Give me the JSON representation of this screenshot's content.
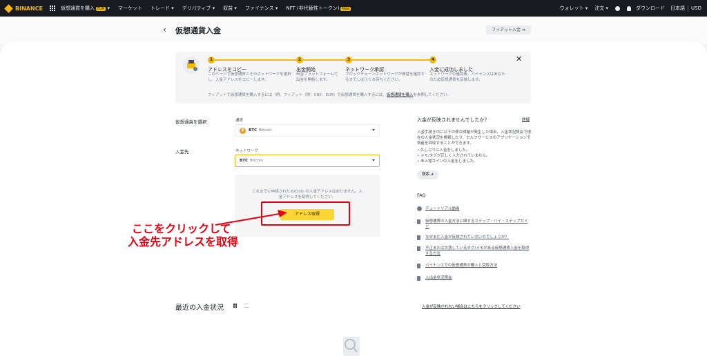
{
  "topbar": {
    "brand": "BINANCE",
    "nav": [
      "仮想通貨を購入",
      "マーケット",
      "トレード",
      "デリバティブ",
      "収益",
      "ファイナンス",
      "NFT (非代替性トークン)"
    ],
    "buy_badge": "EUR",
    "nft_badge": "New",
    "wallet": "ウォレット",
    "orders": "注文",
    "download": "ダウンロード",
    "language": "日本語",
    "currency": "USD"
  },
  "header": {
    "title": "仮想通貨入金",
    "fiat_button": "フィアット入金 ➔"
  },
  "steps": [
    {
      "num": "1",
      "title": "アドレスをコピー",
      "desc": "このページで仮想通貨とそのネットワークを選択し、入金アドレスをコピーします。"
    },
    {
      "num": "2",
      "title": "出金開始",
      "desc": "出金プラットフォームで出金を開始します。"
    },
    {
      "num": "3",
      "title": "ネットワーク承認",
      "desc": "ブロックチェーンネットワークが振替を確認するまでしばらくお待ちください。"
    },
    {
      "num": "4",
      "title": "入金に成功しました",
      "desc": "ネットワークの確認後、バイナンスはあなたのため仮想通貨を反映します。"
    }
  ],
  "steps_note": {
    "text": "フィアットで仮想通貨を購入するには（例、フィアット（例：CNY、EUR）で仮想通貨を購入するには、",
    "link": "仮想通貨を購入",
    "suffix": "を参照してください。"
  },
  "form": {
    "select_coin_label": "仮想通貨を選択",
    "coin_field_label": "通貨",
    "coin_code": "BTC",
    "coin_name": "Bitcoin",
    "deposit_to_label": "入金先",
    "network_field_label": "ネットワーク",
    "network_code": "BTC",
    "network_name": "Bitcoin",
    "address_message": "これまでに申請された Bitcoin の入金アドレスはありません。入金アドレスを取得してください。",
    "get_address_button": "アドレス取得"
  },
  "annotation": {
    "line1": "ここをクリックして",
    "line2": "入金先アドレスを取得",
    "color": "#e60012"
  },
  "side": {
    "title": "入金が反映されませんでしたか？",
    "detail_link": "詳細",
    "description": "入金手続き中に以下の様な問題が発生した場合、入金状況照会で現在の入金状況を検索したり、セルフサービスのアプリケーションで資産を回収することができます。",
    "reasons": [
      "久しぶりに入金をしました。",
      "メモ/タグが正しく入力されていません。",
      "未上場コインの入金をしました。"
    ],
    "search_button": "検索 ➔"
  },
  "faq": {
    "title": "FAQ",
    "items": [
      "チュートリアル動画",
      "仮想通貨の入金方法に関するステップ・バイ・ステップガイド",
      "なぜまだ入金が反映されていないのでしょうか？",
      "不正または欠落しているタグ/メモがある仮想通貨入金を取得する方法",
      "バイナンスでの仮想通貨の購入と受取方法",
      "入出金状況照会"
    ]
  },
  "recent": {
    "title": "最近の入金状況",
    "link": "入金が反映されない場合はこちらをクリックしてください"
  },
  "colors": {
    "brand_yellow": "#f0b90b",
    "button_yellow": "#fcd535",
    "topbar_bg": "#181a20"
  }
}
